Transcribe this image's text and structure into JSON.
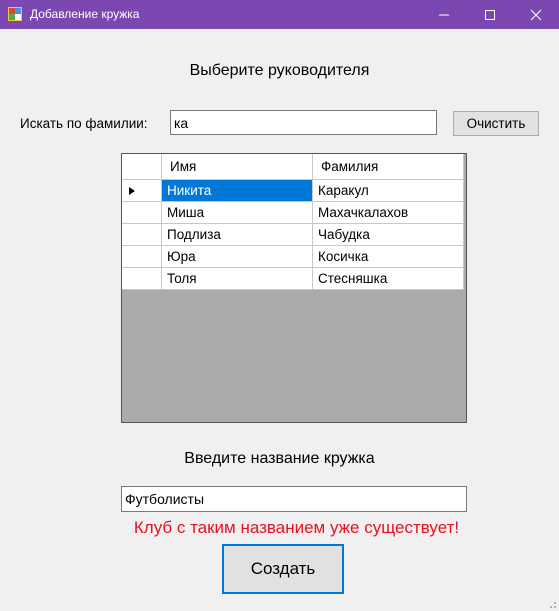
{
  "window": {
    "title": "Добавление кружка",
    "accent": "#7a48b0"
  },
  "heading_leader": "Выберите руководителя",
  "search": {
    "label": "Искать по фамилии:",
    "value": "ка",
    "clear_label": "Очистить"
  },
  "grid": {
    "columns": [
      "Имя",
      "Фамилия"
    ],
    "rows": [
      {
        "name": "Никита",
        "surname": "Каракул",
        "selected": true
      },
      {
        "name": "Миша",
        "surname": "Махачкалахов",
        "selected": false
      },
      {
        "name": "Подлиза",
        "surname": "Чабудка",
        "selected": false
      },
      {
        "name": "Юра",
        "surname": "Косичка",
        "selected": false
      },
      {
        "name": "Толя",
        "surname": "Стесняшка",
        "selected": false
      }
    ],
    "current_row_indicator": "arrow-right-icon"
  },
  "heading_club": "Введите название кружка",
  "club_name": {
    "value": "Футболисты"
  },
  "error": {
    "text": "Клуб с таким названием уже существует!",
    "color": "#e81123"
  },
  "create_label": "Создать"
}
